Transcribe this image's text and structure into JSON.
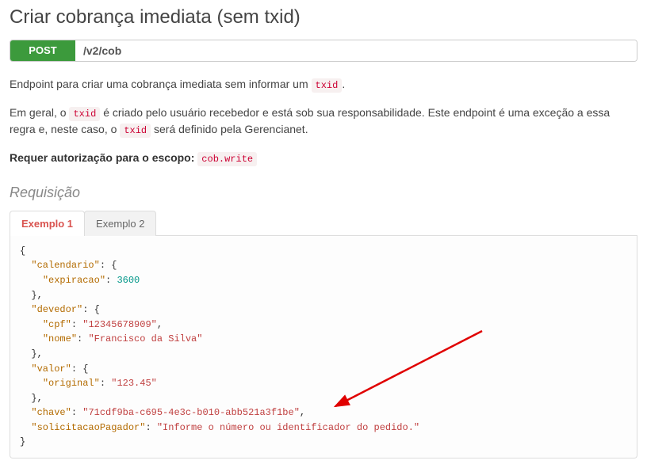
{
  "title": "Criar cobrança imediata (sem txid)",
  "endpoint": {
    "method": "POST",
    "path": "/v2/cob"
  },
  "desc1": {
    "before": "Endpoint para criar uma cobrança imediata sem informar um ",
    "code": "txid",
    "after": "."
  },
  "desc2": {
    "p1": "Em geral, o ",
    "c1": "txid",
    "p2": " é criado pelo usuário recebedor e está sob sua responsabilidade. Este endpoint é uma exceção a essa regra e, neste caso, o ",
    "c2": "txid",
    "p3": " será definido pela Gerencianet."
  },
  "auth": {
    "label": "Requer autorização para o escopo",
    "code": "cob.write"
  },
  "section": "Requisição",
  "tabs": [
    "Exemplo 1",
    "Exemplo 2"
  ],
  "json": {
    "k_calendario": "calendario",
    "k_expiracao": "expiracao",
    "v_expiracao": "3600",
    "k_devedor": "devedor",
    "k_cpf": "cpf",
    "v_cpf": "12345678909",
    "k_nome": "nome",
    "v_nome": "Francisco da Silva",
    "k_valor": "valor",
    "k_original": "original",
    "v_original": "123.45",
    "k_chave": "chave",
    "v_chave": "71cdf9ba-c695-4e3c-b010-abb521a3f1be",
    "k_solic": "solicitacaoPagador",
    "v_solic": "Informe o número ou identificador do pedido."
  }
}
